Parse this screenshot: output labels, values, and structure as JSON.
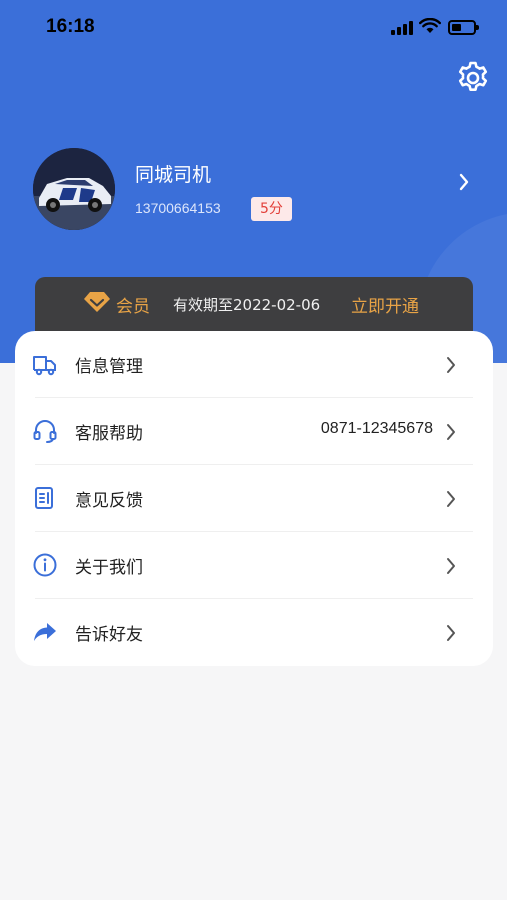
{
  "status_bar": {
    "time": "16:18"
  },
  "colors": {
    "primary": "#3b6fd9",
    "vip_gold": "#e8a346",
    "vip_bg": "#3e3e40",
    "score_red": "#e2403a"
  },
  "profile": {
    "name": "同城司机",
    "phone": "13700664153",
    "score_badge": "5分"
  },
  "vip": {
    "label": "会员",
    "expiry": "有效期至2022-02-06",
    "open_label": "立即开通"
  },
  "menu": [
    {
      "label": "信息管理",
      "icon": "truck-icon",
      "value": ""
    },
    {
      "label": "客服帮助",
      "icon": "headset-icon",
      "value": "0871-12345678"
    },
    {
      "label": "意见反馈",
      "icon": "feedback-icon",
      "value": ""
    },
    {
      "label": "关于我们",
      "icon": "info-icon",
      "value": ""
    },
    {
      "label": "告诉好友",
      "icon": "share-icon",
      "value": ""
    }
  ]
}
